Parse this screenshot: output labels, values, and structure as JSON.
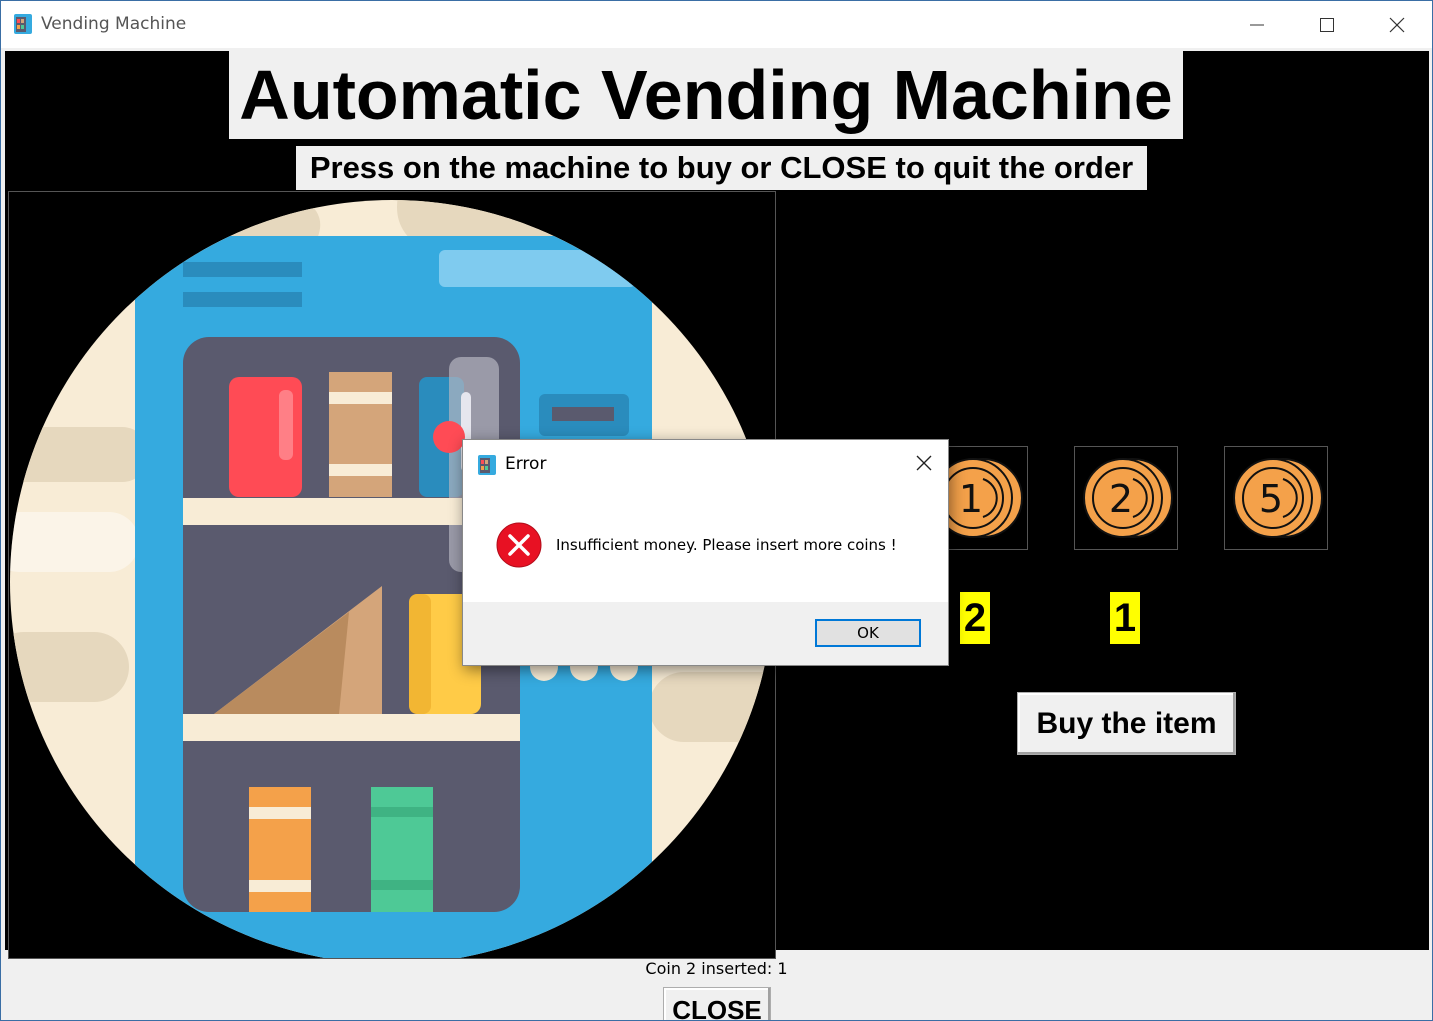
{
  "window": {
    "title": "Vending Machine",
    "icon": "vending-machine-app-icon"
  },
  "heading": "Automatic Vending Machine",
  "subheading": "Press on the machine to buy or CLOSE to quit the order",
  "coins": [
    {
      "label": "1",
      "count": "2"
    },
    {
      "label": "2",
      "count": "1"
    },
    {
      "label": "5",
      "count": ""
    }
  ],
  "buy_button": "Buy the item",
  "status": "Coin 2 inserted: 1",
  "close_button": "CLOSE",
  "dialog": {
    "title": "Error",
    "message": "Insufficient money. Please insert more coins !",
    "ok_label": "OK",
    "icon": "error-icon"
  },
  "colors": {
    "background": "#000000",
    "count_badge": "#ffff00",
    "machine_blue": "#35aadf",
    "coin_orange": "#f4a14a",
    "error_red": "#e81123"
  }
}
